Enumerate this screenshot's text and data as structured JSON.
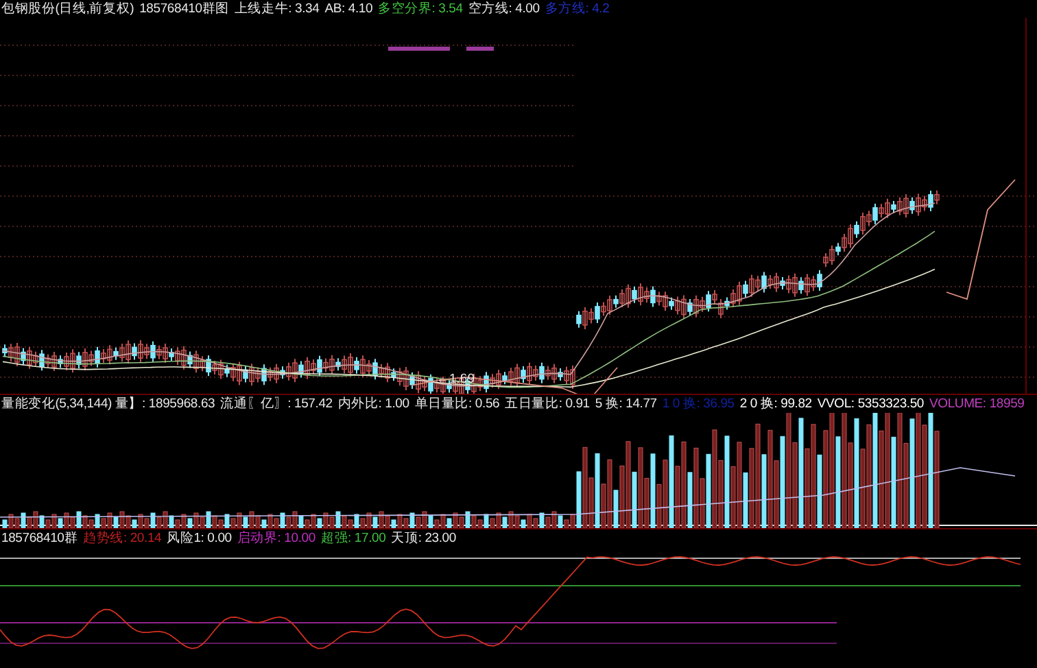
{
  "main_header": {
    "title": "包钢股份(日线,前复权)",
    "formula": "185768410群图",
    "items": [
      {
        "text": "上线走牛: 3.34",
        "color": "#e8e8e8"
      },
      {
        "text": "AB: 4.10",
        "color": "#e8e8e8"
      },
      {
        "text": "多空分界: 3.54",
        "color": "#40c040"
      },
      {
        "text": "空方线: 4.00",
        "color": "#e8e8e8"
      },
      {
        "text": "多方线: 4.2",
        "color": "#2030c0"
      }
    ]
  },
  "main_chart": {
    "low_label": "←1.69"
  },
  "volume_header": {
    "items": [
      {
        "text": "量能变化(5,34,144) 量】: 1895968.63",
        "color": "#e8e8e8"
      },
      {
        "text": "流通〖亿〗: 157.42",
        "color": "#e8e8e8"
      },
      {
        "text": "内外比: 1.00",
        "color": "#e8e8e8"
      },
      {
        "text": "单日量比: 0.56",
        "color": "#e8e8e8"
      },
      {
        "text": "五日量比: 0.91",
        "color": "#e8e8e8"
      },
      {
        "text": "5 换: 14.77",
        "color": "#e8e8e8"
      },
      {
        "text": "1 0 换: 36.95",
        "color": "#1020a0"
      },
      {
        "text": "2 0 换: 99.82",
        "color": "#ffffff"
      },
      {
        "text": "VVOL: 5353323.50",
        "color": "#ffffff"
      },
      {
        "text": "VOLUME: 18959",
        "color": "#c040c0"
      }
    ]
  },
  "oscillator_header": {
    "items": [
      {
        "text": "185768410群",
        "color": "#e8e8e8"
      },
      {
        "text": "趋势线: 20.14",
        "color": "#c02020"
      },
      {
        "text": "风险1: 0.00",
        "color": "#e8e8e8"
      },
      {
        "text": "启动界: 10.00",
        "color": "#c030c0"
      },
      {
        "text": "超强: 17.00",
        "color": "#40c040"
      },
      {
        "text": "天顶: 23.00",
        "color": "#e8e8e8"
      }
    ]
  }
}
